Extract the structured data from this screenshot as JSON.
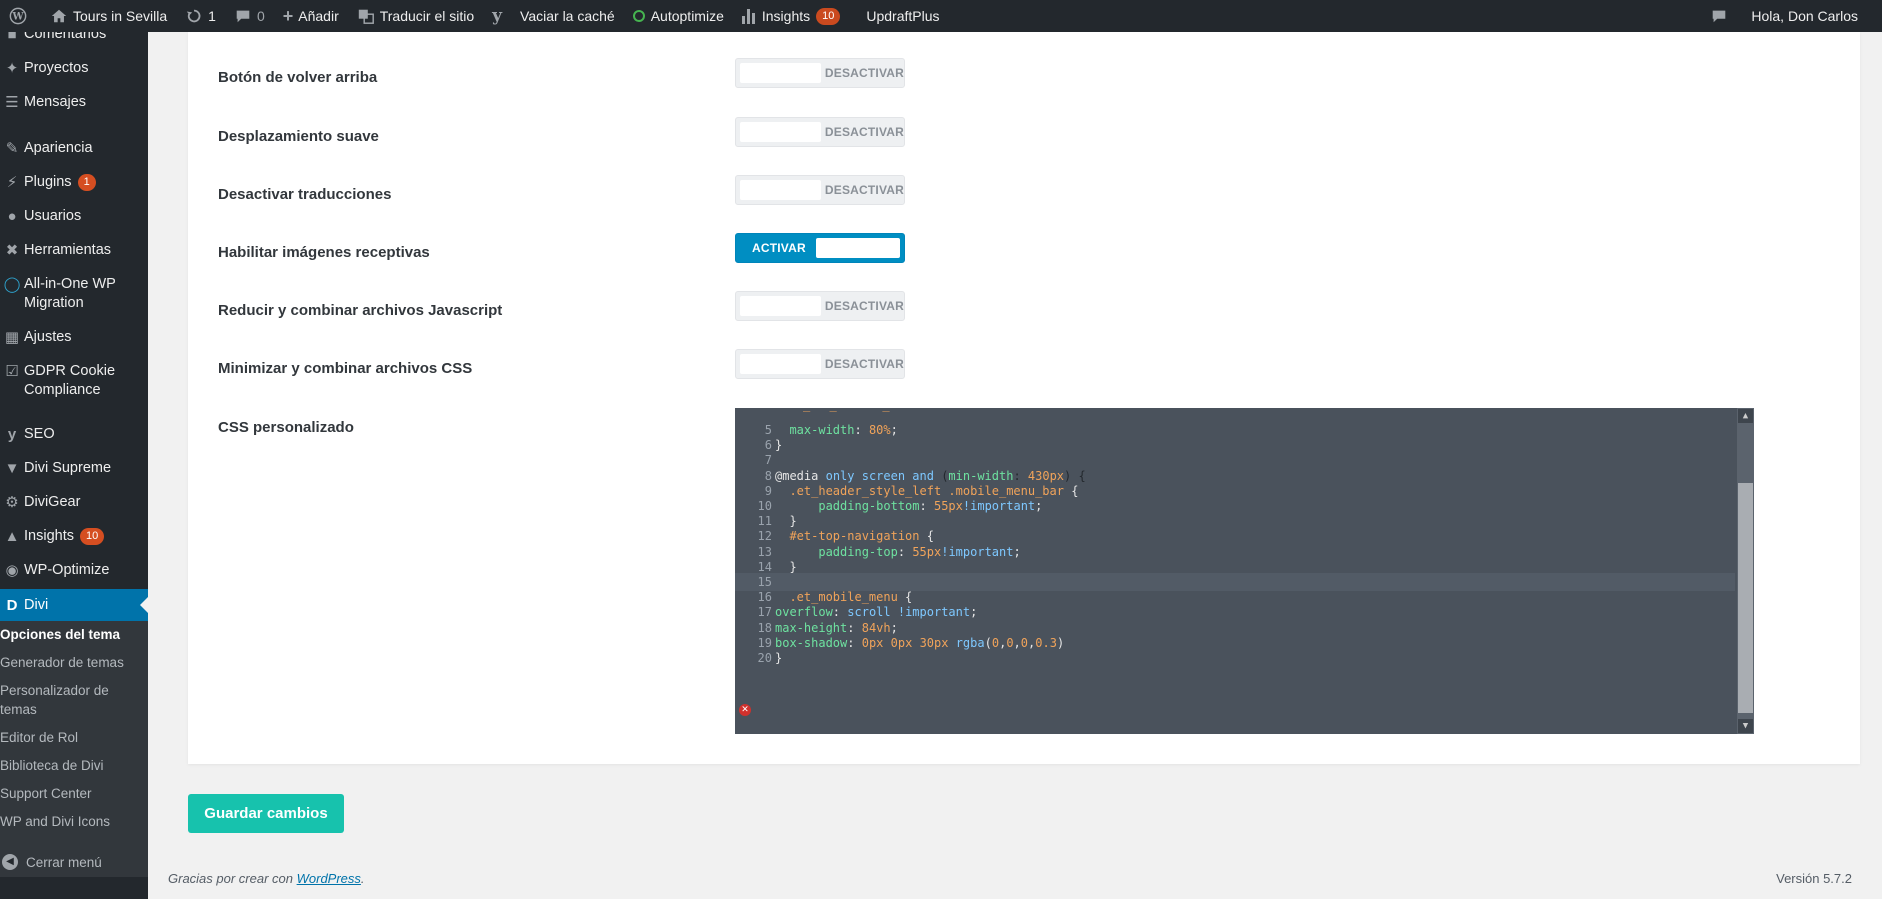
{
  "adminbar": {
    "site_name": "Tours in Sevilla",
    "updates_count": "1",
    "comments_count": "0",
    "new_label": "Añadir",
    "translate_label": "Traducir el sitio",
    "cache_label": "Vaciar la caché",
    "autoptimize_label": "Autoptimize",
    "insights_label": "Insights",
    "insights_count": "10",
    "updraft_label": "UpdraftPlus",
    "greeting": "Hola, Don Carlos"
  },
  "sidebar": {
    "items": [
      {
        "label": "Comentarios",
        "icon": "comment-icon"
      },
      {
        "label": "Proyectos",
        "icon": "pin-icon"
      },
      {
        "label": "Mensajes",
        "icon": "messages-icon"
      },
      {
        "label": "Apariencia",
        "icon": "brush-icon"
      },
      {
        "label": "Plugins",
        "icon": "plugin-icon",
        "badge": "1"
      },
      {
        "label": "Usuarios",
        "icon": "user-icon"
      },
      {
        "label": "Herramientas",
        "icon": "wrench-icon"
      },
      {
        "label": "All-in-One WP Migration",
        "icon": "migration-icon"
      },
      {
        "label": "Ajustes",
        "icon": "settings-icon"
      },
      {
        "label": "GDPR Cookie Compliance",
        "icon": "checkbox-icon"
      },
      {
        "label": "SEO",
        "icon": "yoast-icon"
      },
      {
        "label": "Divi Supreme",
        "icon": "divi-supreme-icon"
      },
      {
        "label": "DiviGear",
        "icon": "gear-icon"
      },
      {
        "label": "Insights",
        "icon": "insights-icon",
        "badge": "10"
      },
      {
        "label": "WP-Optimize",
        "icon": "optimize-icon"
      },
      {
        "label": "Divi",
        "icon": "divi-icon"
      }
    ],
    "submenu": [
      "Opciones del tema",
      "Generador de temas",
      "Personalizador de temas",
      "Editor de Rol",
      "Biblioteca de Divi",
      "Support Center",
      "WP and Divi Icons"
    ],
    "collapse_label": "Cerrar menú"
  },
  "options": [
    {
      "label": "Botón de volver arriba",
      "state": "DESACTIVAR"
    },
    {
      "label": "Desplazamiento suave",
      "state": "DESACTIVAR"
    },
    {
      "label": "Desactivar traducciones",
      "state": "DESACTIVAR"
    },
    {
      "label": "Habilitar imágenes receptivas",
      "state": "ACTIVAR"
    },
    {
      "label": "Reducir y combinar archivos Javascript",
      "state": "DESACTIVAR"
    },
    {
      "label": "Minimizar y combinar archivos CSS",
      "state": "DESACTIVAR"
    }
  ],
  "custom_css": {
    "label": "CSS personalizado",
    "line_numbers": [
      "5",
      "6",
      "7",
      "8",
      "9",
      "10",
      "11",
      "12",
      "13",
      "14",
      "15",
      "16",
      "17",
      "18",
      "19",
      "20"
    ],
    "lines": [
      "  max-width: 80%;",
      "}",
      "",
      "@media only screen and (min-width: 430px) {",
      "  .et_header_style_left .mobile_menu_bar {",
      "      padding-bottom: 55px!important;",
      "  }",
      "  #et-top-navigation {",
      "      padding-top: 55px!important;",
      "  }",
      "",
      "  .et_mobile_menu {",
      "overflow: scroll !important;",
      "max-height: 84vh;",
      "box-shadow: 0px 0px 30px rgba(0,0,0,0.3)",
      "}"
    ]
  },
  "save_label": "Guardar cambios",
  "footer": {
    "thanks_prefix": "Gracias por crear con ",
    "wordpress_link": "WordPress",
    "thanks_suffix": ".",
    "version": "Versión 5.7.2"
  }
}
